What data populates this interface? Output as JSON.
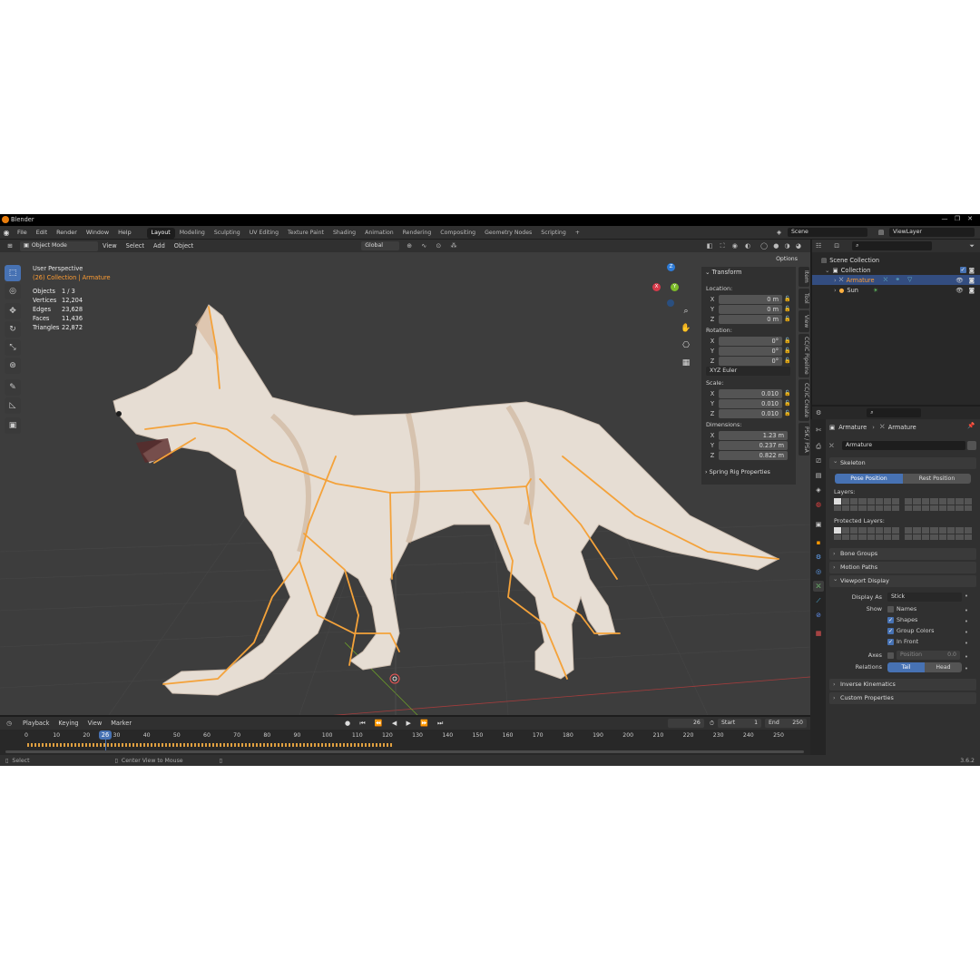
{
  "title": "Blender",
  "window_buttons": [
    "—",
    "❐",
    "✕"
  ],
  "menu": [
    "File",
    "Edit",
    "Render",
    "Window",
    "Help"
  ],
  "workspaces": [
    {
      "label": "Layout",
      "active": true
    },
    {
      "label": "Modeling"
    },
    {
      "label": "Sculpting"
    },
    {
      "label": "UV Editing"
    },
    {
      "label": "Texture Paint"
    },
    {
      "label": "Shading"
    },
    {
      "label": "Animation"
    },
    {
      "label": "Rendering"
    },
    {
      "label": "Compositing"
    },
    {
      "label": "Geometry Nodes"
    },
    {
      "label": "Scripting"
    }
  ],
  "add_workspace": "+",
  "scene": {
    "value": "Scene"
  },
  "view_layer": {
    "value": "ViewLayer"
  },
  "viewport_header": {
    "mode": "Object Mode",
    "menus": [
      "View",
      "Select",
      "Add",
      "Object"
    ],
    "orientation": "Global",
    "options": "Options"
  },
  "viewport": {
    "view_name": "User Perspective",
    "collection_path": "(26) Collection | Armature",
    "stats": [
      {
        "label": "Objects",
        "value": "1 / 3"
      },
      {
        "label": "Vertices",
        "value": "12,204"
      },
      {
        "label": "Edges",
        "value": "23,628"
      },
      {
        "label": "Faces",
        "value": "11,436"
      },
      {
        "label": "Triangles",
        "value": "22,872"
      }
    ],
    "gizmo": {
      "z": "Z",
      "y": "Y",
      "x": "X"
    }
  },
  "transform_panel": {
    "title": "Transform",
    "location_label": "Location:",
    "location": [
      {
        "axis": "X",
        "value": "0 m"
      },
      {
        "axis": "Y",
        "value": "0 m"
      },
      {
        "axis": "Z",
        "value": "0 m"
      }
    ],
    "rotation_label": "Rotation:",
    "rotation": [
      {
        "axis": "X",
        "value": "0°"
      },
      {
        "axis": "Y",
        "value": "0°"
      },
      {
        "axis": "Z",
        "value": "0°"
      }
    ],
    "rotation_mode": "XYZ Euler",
    "scale_label": "Scale:",
    "scale": [
      {
        "axis": "X",
        "value": "0.010"
      },
      {
        "axis": "Y",
        "value": "0.010"
      },
      {
        "axis": "Z",
        "value": "0.010"
      }
    ],
    "dimensions_label": "Dimensions:",
    "dimensions": [
      {
        "axis": "X",
        "value": "1.23 m"
      },
      {
        "axis": "Y",
        "value": "0.237 m"
      },
      {
        "axis": "Z",
        "value": "0.822 m"
      }
    ],
    "spring_rig": "Spring Rig Properties"
  },
  "sidebar_tabs": [
    "Item",
    "Tool",
    "View",
    "CC/iC Pipeline",
    "CC/iC Create",
    "PSK / PSA"
  ],
  "outliner": {
    "search_placeholder": "",
    "scene_collection": "Scene Collection",
    "collection": "Collection",
    "items": [
      {
        "label": "Armature",
        "selected": true
      },
      {
        "label": "Sun",
        "selected": false
      }
    ]
  },
  "properties": {
    "breadcrumb": [
      "Armature",
      "Armature"
    ],
    "data_name": "Armature",
    "skeleton": "Skeleton",
    "pose_position": "Pose Position",
    "rest_position": "Rest Position",
    "layers_label": "Layers:",
    "protected_layers_label": "Protected Layers:",
    "bone_groups": "Bone Groups",
    "motion_paths": "Motion Paths",
    "viewport_display": "Viewport Display",
    "display_as_label": "Display As",
    "display_as_value": "Stick",
    "show_label": "Show",
    "show_options": [
      {
        "label": "Names",
        "checked": false
      },
      {
        "label": "Shapes",
        "checked": true
      },
      {
        "label": "Group Colors",
        "checked": true
      },
      {
        "label": "In Front",
        "checked": true
      }
    ],
    "axes_label": "Axes",
    "position_label": "Position",
    "position_value": "0.0",
    "relations_label": "Relations",
    "tail": "Tail",
    "head": "Head",
    "inverse_kinematics": "Inverse Kinematics",
    "custom_properties": "Custom Properties"
  },
  "timeline": {
    "menus": [
      "Playback",
      "Keying",
      "View",
      "Marker"
    ],
    "current_frame": "26",
    "start_label": "Start",
    "start": "1",
    "end_label": "End",
    "end": "250",
    "ticks": [
      "0",
      "10",
      "20",
      "30",
      "40",
      "50",
      "60",
      "70",
      "80",
      "90",
      "100",
      "110",
      "120",
      "130",
      "140",
      "150",
      "160",
      "170",
      "180",
      "190",
      "200",
      "210",
      "220",
      "230",
      "240",
      "250"
    ],
    "playhead": "26"
  },
  "statusbar": {
    "left": "Select",
    "middle": "Center View to Mouse",
    "version": "3.6.2"
  },
  "colors": {
    "accent": "#4772b3",
    "bone": "#f4a23a",
    "bg": "#3d3d3d",
    "header": "#303030"
  }
}
